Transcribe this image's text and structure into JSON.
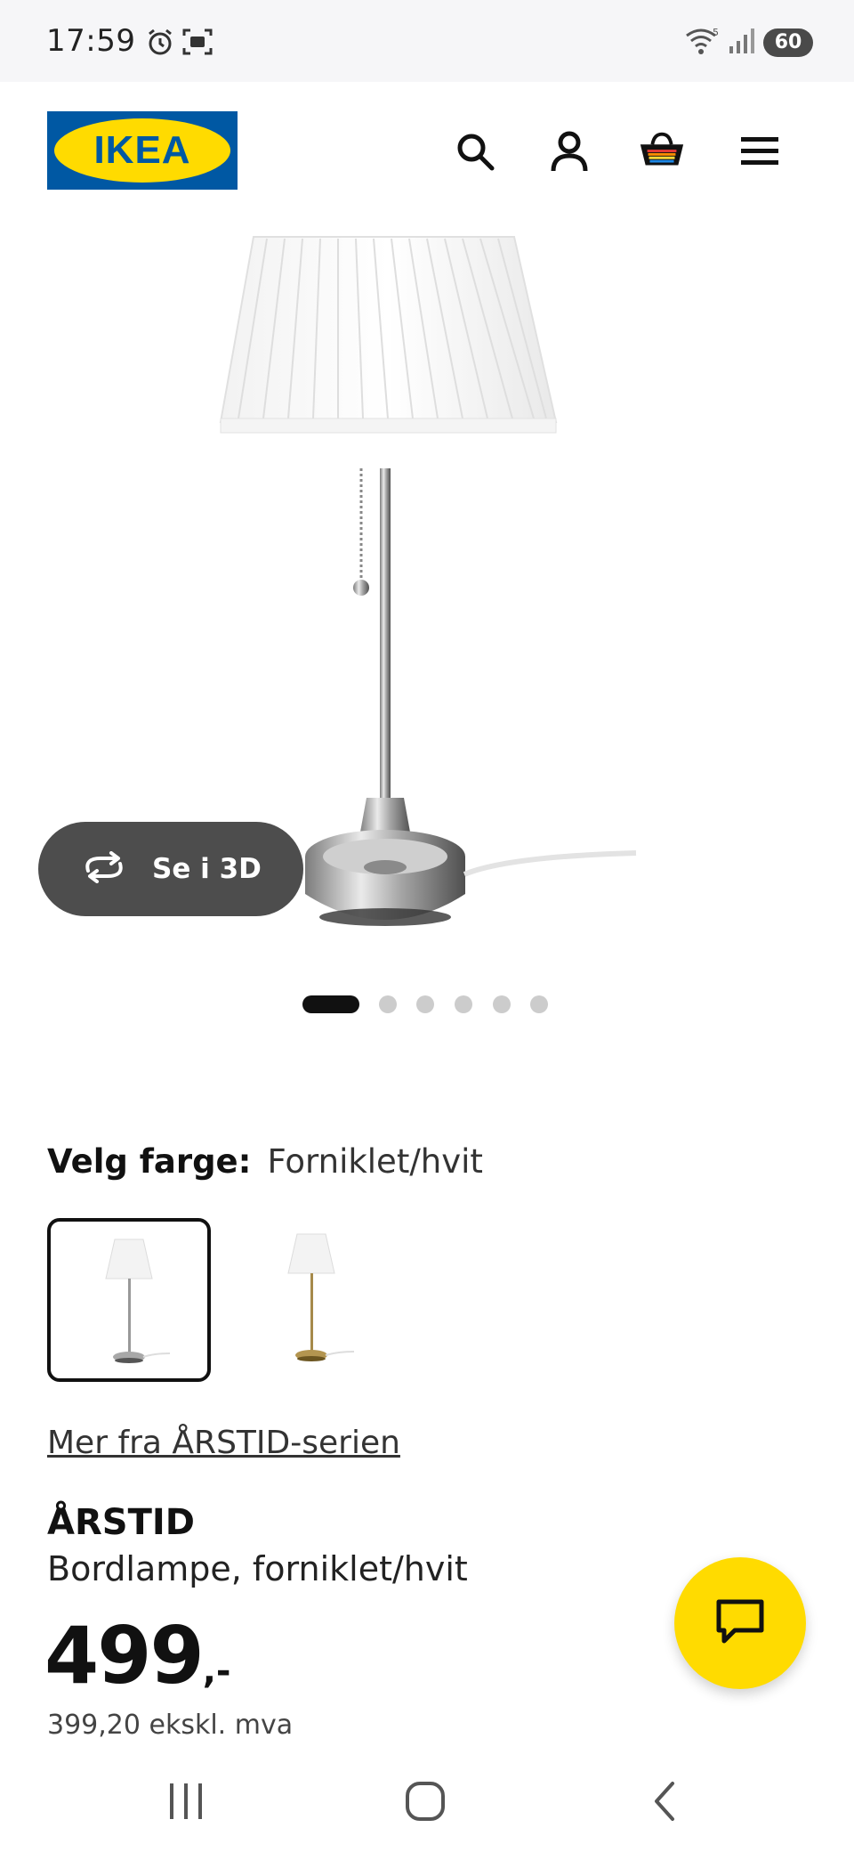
{
  "status_bar": {
    "time": "17:59",
    "battery": "60",
    "icons": [
      "alarm-icon",
      "screenshot-icon",
      "wifi-icon",
      "signal-icon",
      "battery-icon"
    ]
  },
  "header": {
    "logo_text": "IKEA",
    "icons": [
      "search-icon",
      "account-icon",
      "cart-icon",
      "menu-icon"
    ]
  },
  "gallery": {
    "view3d_label": "Se i 3D",
    "image_count": 6,
    "active_index": 0
  },
  "color_selector": {
    "label": "Velg farge:",
    "value": "Forniklet/hvit",
    "options": [
      "Forniklet/hvit",
      "messing/hvit"
    ],
    "selected_index": 0
  },
  "series_link": "Mer fra ÅRSTID-serien",
  "product": {
    "name": "ÅRSTID",
    "description": "Bordlampe, forniklet/hvit",
    "price": "499",
    "price_suffix": ",-",
    "price_ex_vat": "399,20 ekskl. mva"
  },
  "colors": {
    "ikea_blue": "#0058a3",
    "ikea_yellow": "#ffdb00",
    "pill_gray": "#4d4d4d"
  }
}
